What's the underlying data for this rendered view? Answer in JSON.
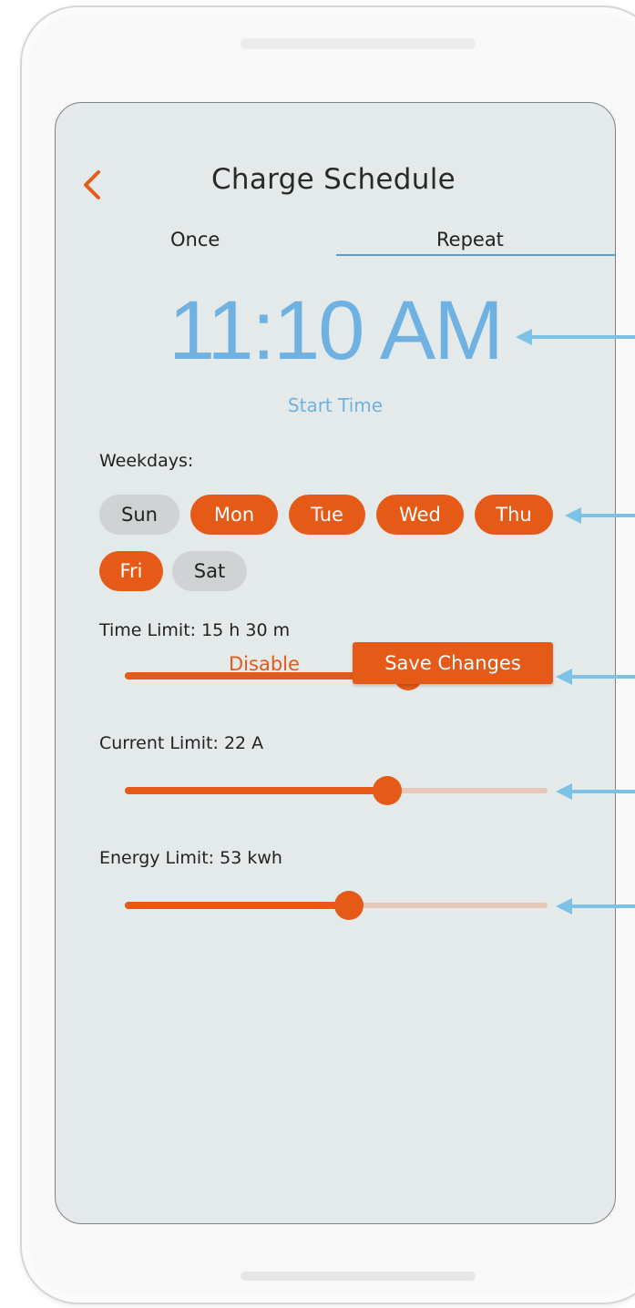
{
  "header": {
    "title": "Charge Schedule",
    "back_icon": "chevron-left-icon"
  },
  "tabs": [
    {
      "label": "Once",
      "active": false
    },
    {
      "label": "Repeat",
      "active": true
    }
  ],
  "schedule": {
    "start_time": "11:10 AM",
    "start_time_label": "Start Time"
  },
  "weekdays": {
    "label": "Weekdays:",
    "days": [
      {
        "label": "Sun",
        "selected": false
      },
      {
        "label": "Mon",
        "selected": true
      },
      {
        "label": "Tue",
        "selected": true
      },
      {
        "label": "Wed",
        "selected": true
      },
      {
        "label": "Thu",
        "selected": true
      },
      {
        "label": "Fri",
        "selected": true
      },
      {
        "label": "Sat",
        "selected": false
      }
    ]
  },
  "limits": {
    "time": {
      "label": "Time Limit: 15 h 30 m",
      "fraction": 0.67
    },
    "current": {
      "label": "Current Limit: 22 A",
      "fraction": 0.62
    },
    "energy": {
      "label": "Energy Limit: 53 kwh",
      "fraction": 0.53
    }
  },
  "actions": {
    "disable_label": "Disable",
    "save_label": "Save Changes"
  },
  "colors": {
    "accent": "#e55a17",
    "time_blue": "#6fb2e2",
    "tab_underline": "#5a9fd4",
    "annotation_arrow": "#7cc2e6",
    "screen_bg": "#e4e9ea"
  }
}
